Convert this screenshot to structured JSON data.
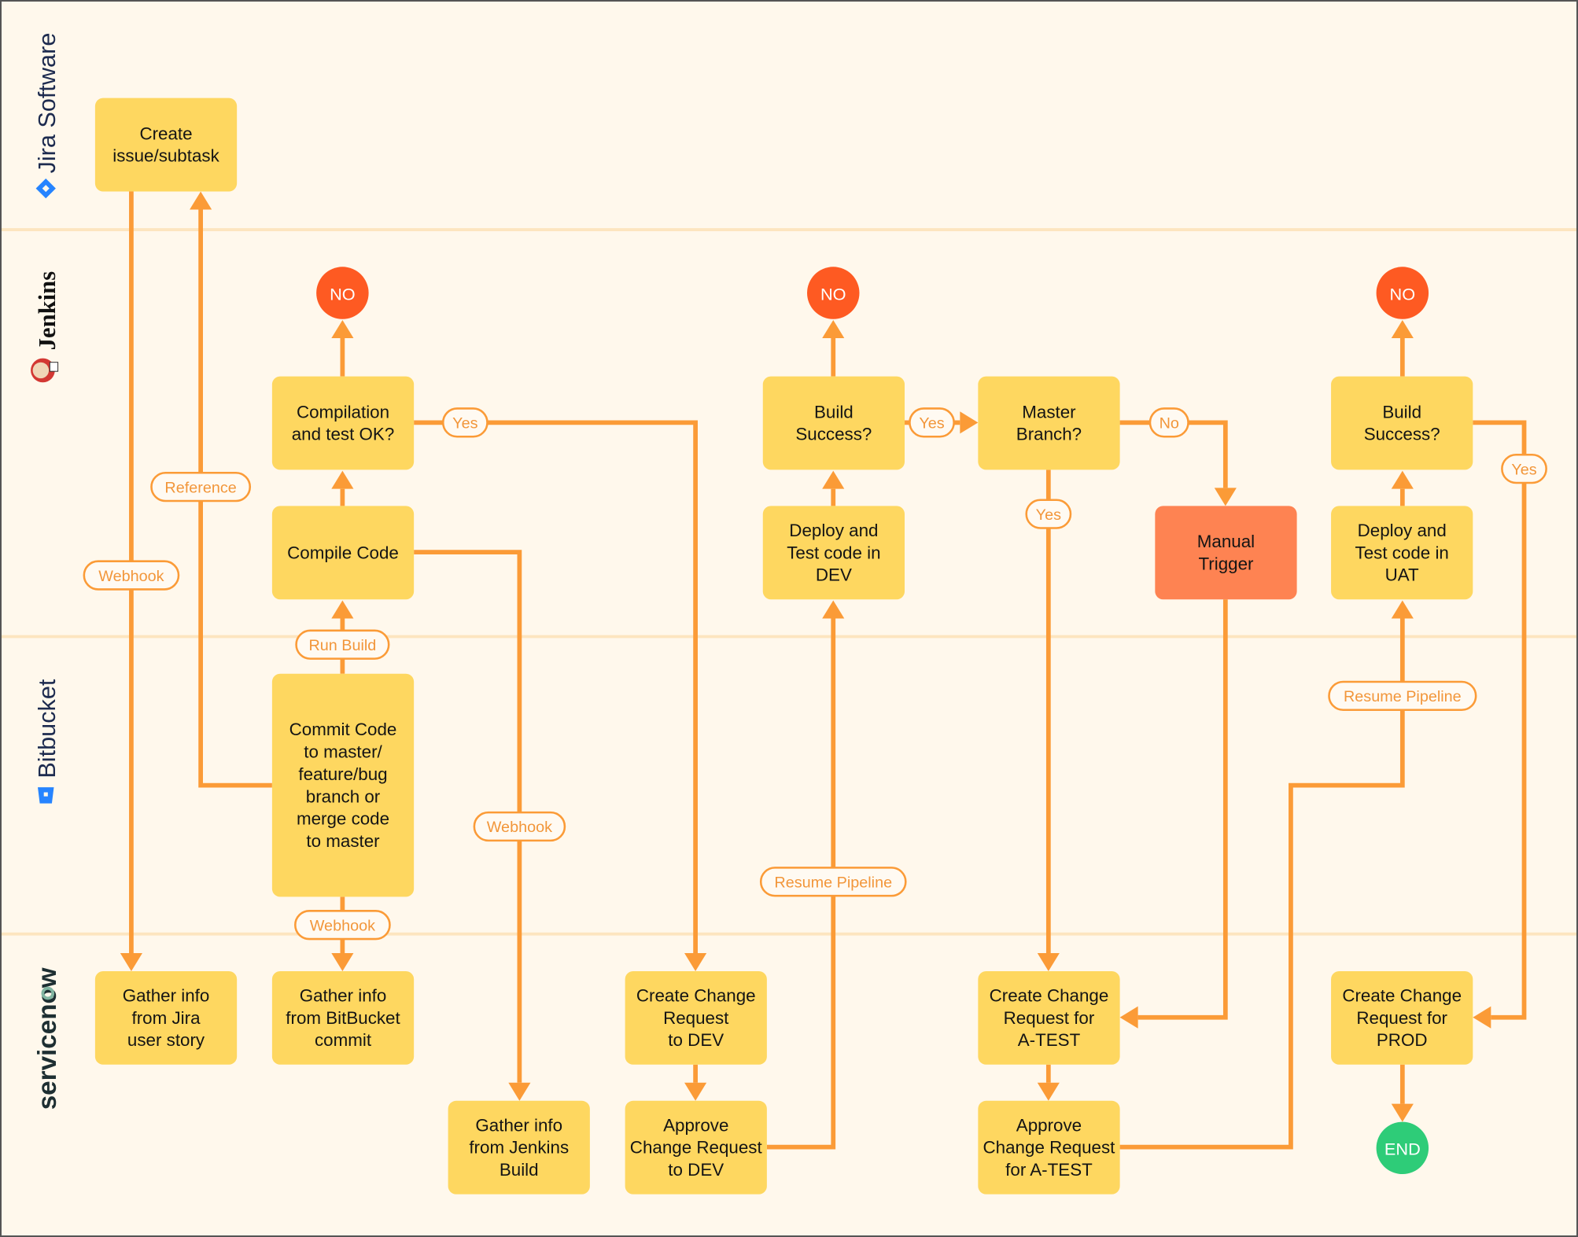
{
  "colors": {
    "background": "#fff8ec",
    "lane_divider": "#fde5bf",
    "edge": "#fb9b37",
    "process_box": "#fed760",
    "manual_box": "#fe8352",
    "no_terminal": "#fe5a22",
    "end_terminal": "#2ecc78",
    "label_text": "#f2963a"
  },
  "lanes": [
    {
      "id": "jira",
      "label": "Jira Software",
      "icon": "jira-diamond-icon"
    },
    {
      "id": "jenkins",
      "label": "Jenkins",
      "icon": "jenkins-butler-icon"
    },
    {
      "id": "bitbucket",
      "label": "Bitbucket",
      "icon": "bitbucket-bucket-icon"
    },
    {
      "id": "servicenow",
      "label": "servicenow",
      "icon": "servicenow-wordmark"
    }
  ],
  "nodes": {
    "create_issue": {
      "lane": "jira",
      "type": "process",
      "lines": [
        "Create",
        "issue/subtask"
      ]
    },
    "compilation_ok": {
      "lane": "jenkins",
      "type": "decision",
      "lines": [
        "Compilation",
        "and test OK?"
      ]
    },
    "compile_code": {
      "lane": "jenkins",
      "type": "process",
      "lines": [
        "Compile Code"
      ]
    },
    "build_success_dev": {
      "lane": "jenkins",
      "type": "decision",
      "lines": [
        "Build",
        "Success?"
      ]
    },
    "deploy_dev": {
      "lane": "jenkins",
      "type": "process",
      "lines": [
        "Deploy and",
        "Test code in",
        "DEV"
      ]
    },
    "master_branch": {
      "lane": "jenkins",
      "type": "decision",
      "lines": [
        "Master",
        "Branch?"
      ]
    },
    "manual_trigger": {
      "lane": "jenkins",
      "type": "manual",
      "lines": [
        "Manual",
        "Trigger"
      ]
    },
    "build_success_uat": {
      "lane": "jenkins",
      "type": "decision",
      "lines": [
        "Build",
        "Success?"
      ]
    },
    "deploy_uat": {
      "lane": "jenkins",
      "type": "process",
      "lines": [
        "Deploy and",
        "Test code in",
        "UAT"
      ]
    },
    "commit_code": {
      "lane": "bitbucket",
      "type": "process",
      "lines": [
        "Commit Code",
        "to master/",
        "feature/bug",
        "branch or",
        "merge code",
        "to master"
      ]
    },
    "gather_jira": {
      "lane": "servicenow",
      "type": "process",
      "lines": [
        "Gather info",
        "from Jira",
        "user story"
      ]
    },
    "gather_bitbucket": {
      "lane": "servicenow",
      "type": "process",
      "lines": [
        "Gather info",
        "from BitBucket",
        "commit"
      ]
    },
    "gather_jenkins": {
      "lane": "servicenow",
      "type": "process",
      "lines": [
        "Gather info",
        "from Jenkins",
        "Build"
      ]
    },
    "create_cr_dev": {
      "lane": "servicenow",
      "type": "process",
      "lines": [
        "Create Change",
        "Request",
        "to DEV"
      ]
    },
    "approve_cr_dev": {
      "lane": "servicenow",
      "type": "process",
      "lines": [
        "Approve",
        "Change Request",
        "to DEV"
      ]
    },
    "create_cr_atest": {
      "lane": "servicenow",
      "type": "process",
      "lines": [
        "Create Change",
        "Request for",
        "A-TEST"
      ]
    },
    "approve_cr_atest": {
      "lane": "servicenow",
      "type": "process",
      "lines": [
        "Approve",
        "Change Request",
        "for A-TEST"
      ]
    },
    "create_cr_prod": {
      "lane": "servicenow",
      "type": "process",
      "lines": [
        "Create Change",
        "Request for",
        "PROD"
      ]
    }
  },
  "terminals": {
    "no_1": {
      "label": "NO",
      "type": "no"
    },
    "no_2": {
      "label": "NO",
      "type": "no"
    },
    "no_3": {
      "label": "NO",
      "type": "no"
    },
    "end": {
      "label": "END",
      "type": "end"
    }
  },
  "edge_labels": {
    "webhook_jira": "Webhook",
    "reference": "Reference",
    "run_build": "Run Build",
    "webhook_commit": "Webhook",
    "webhook_compile": "Webhook",
    "yes_compilation": "Yes",
    "yes_build_dev": "Yes",
    "no_master": "No",
    "yes_master": "Yes",
    "yes_build_uat": "Yes",
    "resume_pipeline_dev": "Resume Pipeline",
    "resume_pipeline_uat": "Resume Pipeline"
  },
  "edges": [
    {
      "from": "create_issue",
      "to": "gather_jira",
      "label": "webhook_jira"
    },
    {
      "from": "commit_code",
      "to": "create_issue",
      "label": "reference"
    },
    {
      "from": "commit_code",
      "to": "compile_code",
      "label": "run_build"
    },
    {
      "from": "commit_code",
      "to": "gather_bitbucket",
      "label": "webhook_commit"
    },
    {
      "from": "compile_code",
      "to": "compilation_ok"
    },
    {
      "from": "compile_code",
      "to": "gather_jenkins",
      "label": "webhook_compile"
    },
    {
      "from": "compilation_ok",
      "to": "no_1"
    },
    {
      "from": "compilation_ok",
      "to": "create_cr_dev",
      "label": "yes_compilation"
    },
    {
      "from": "create_cr_dev",
      "to": "approve_cr_dev"
    },
    {
      "from": "approve_cr_dev",
      "to": "deploy_dev",
      "label": "resume_pipeline_dev"
    },
    {
      "from": "deploy_dev",
      "to": "build_success_dev"
    },
    {
      "from": "build_success_dev",
      "to": "no_2"
    },
    {
      "from": "build_success_dev",
      "to": "master_branch",
      "label": "yes_build_dev"
    },
    {
      "from": "master_branch",
      "to": "manual_trigger",
      "label": "no_master"
    },
    {
      "from": "master_branch",
      "to": "create_cr_atest",
      "label": "yes_master"
    },
    {
      "from": "manual_trigger",
      "to": "create_cr_atest"
    },
    {
      "from": "create_cr_atest",
      "to": "approve_cr_atest"
    },
    {
      "from": "approve_cr_atest",
      "to": "deploy_uat",
      "label": "resume_pipeline_uat"
    },
    {
      "from": "deploy_uat",
      "to": "build_success_uat"
    },
    {
      "from": "build_success_uat",
      "to": "no_3"
    },
    {
      "from": "build_success_uat",
      "to": "create_cr_prod",
      "label": "yes_build_uat"
    },
    {
      "from": "create_cr_prod",
      "to": "end"
    }
  ]
}
